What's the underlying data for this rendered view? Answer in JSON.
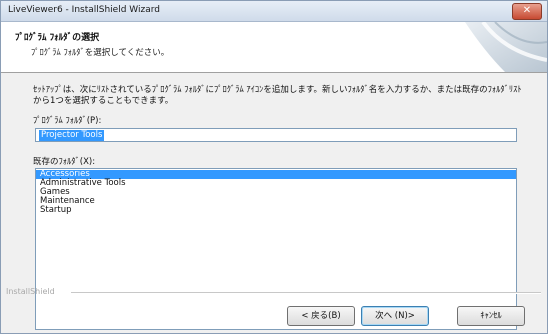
{
  "window": {
    "title": "LiveViewer6 - InstallShield Wizard",
    "close_glyph": "✕"
  },
  "header": {
    "title": "ﾌﾟﾛｸﾞﾗﾑ ﾌｫﾙﾀﾞの選択",
    "subtitle": "ﾌﾟﾛｸﾞﾗﾑ ﾌｫﾙﾀﾞを選択してください。"
  },
  "content": {
    "description": "ｾｯﾄｱｯﾌﾟは、次にﾘｽﾄされているﾌﾟﾛｸﾞﾗﾑ ﾌｫﾙﾀﾞにﾌﾟﾛｸﾞﾗﾑ ｱｲｺﾝを追加します。新しいﾌｫﾙﾀﾞ名を入力するか、または既存のﾌｫﾙﾀﾞﾘｽﾄから1つを選択することもできます。",
    "program_folder_label": "ﾌﾟﾛｸﾞﾗﾑ ﾌｫﾙﾀﾞ(P):",
    "program_folder_value": "Projector Tools",
    "existing_folders_label": "既存のﾌｫﾙﾀﾞ(X):",
    "existing_folders": [
      "Accessories",
      "Administrative Tools",
      "Games",
      "Maintenance",
      "Startup"
    ],
    "selected_folder": "Accessories"
  },
  "footer": {
    "brand": "InstallShield",
    "back_label": "< 戻る(B)",
    "next_label": "次へ (N)>",
    "cancel_label": "ｷｬﾝｾﾙ"
  },
  "colors": {
    "selection": "#3399ff",
    "title_bar": "#dbe5f1",
    "close_button": "#c74a32"
  }
}
